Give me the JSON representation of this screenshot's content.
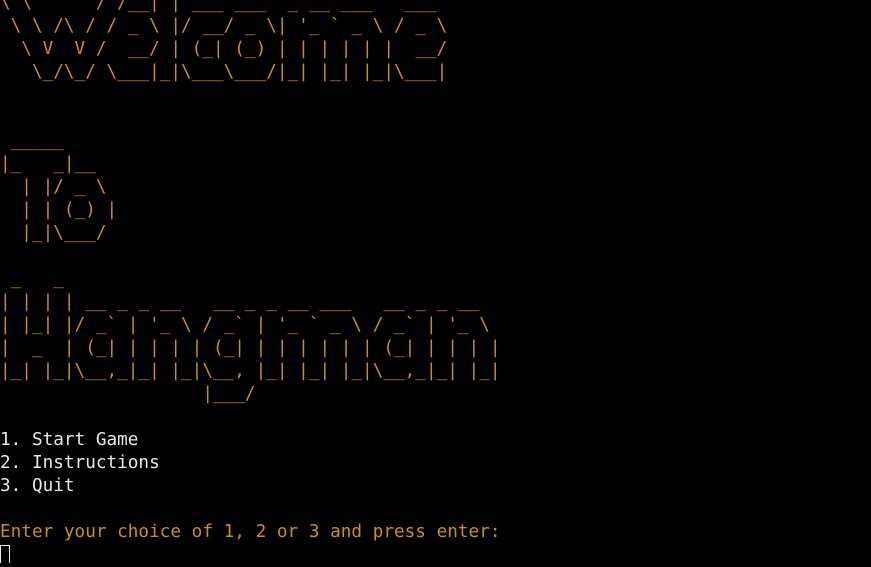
{
  "colors": {
    "background": "#000000",
    "banner": "#c9901a",
    "menu_text": "#e8e8e8",
    "prompt_text": "#c9901a"
  },
  "banner": {
    "welcome": [
      "\\ \\      / /__| | ___ ___  _ __ ___   ___",
      " \\ \\ /\\ / / _ \\ |/ __/ _ \\| '_ ` _ \\ / _ \\",
      "  \\ V  V /  __/ | (_| (_) | | | | | |  __/",
      "   \\_/\\_/ \\___|_|\\___\\___/|_| |_| |_|\\___|"
    ],
    "to": [
      " _____",
      "|_   _|__",
      "  | |/ _ \\",
      "  | | (_) |",
      "  |_|\\___/"
    ],
    "hangman": [
      " _   _",
      "| | | | __ _ _ __   __ _ _ __ ___   __ _ _ __",
      "| |_| |/ _` | '_ \\ / _` | '_ ` _ \\ / _` | '_ \\",
      "|  _  | (_| | | | | (_| | | | | | | (_| | | | |",
      "|_| |_|\\__,_|_| |_|\\__, |_| |_| |_|\\__,_|_| |_|",
      "                   |___/"
    ]
  },
  "menu": {
    "items": [
      "1. Start Game",
      "2. Instructions",
      "3. Quit"
    ]
  },
  "prompt": {
    "text": "Enter your choice of 1, 2 or 3 and press enter:"
  }
}
